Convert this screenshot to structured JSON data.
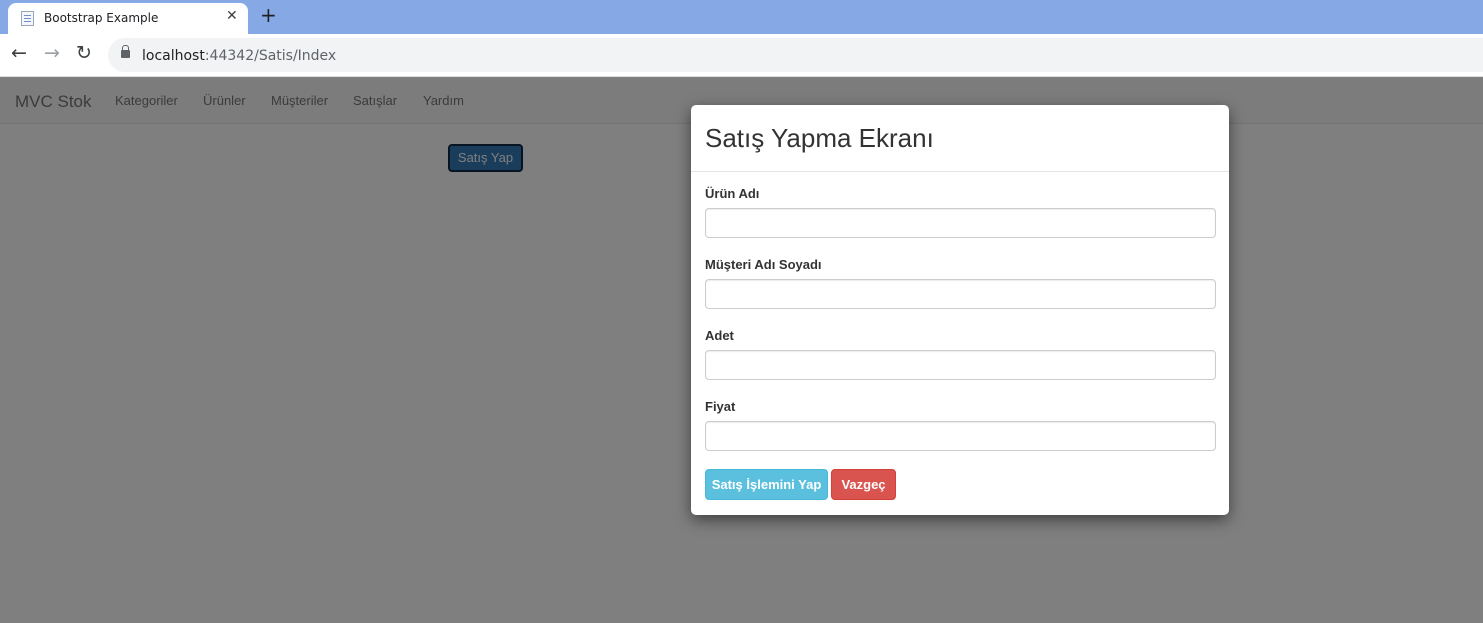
{
  "browser": {
    "tab_title": "Bootstrap Example",
    "close_glyph": "✕",
    "new_tab_glyph": "+",
    "url_host": "localhost",
    "url_rest": ":44342/Satis/Index",
    "back_glyph": "←",
    "forward_glyph": "→",
    "reload_glyph": "↻"
  },
  "navbar": {
    "brand": "MVC Stok",
    "links": [
      "Kategoriler",
      "Ürünler",
      "Müşteriler",
      "Satışlar",
      "Yardım"
    ]
  },
  "page": {
    "sell_button": "Satış Yap"
  },
  "modal": {
    "title": "Satış Yapma Ekranı",
    "fields": [
      {
        "label": "Ürün Adı",
        "value": ""
      },
      {
        "label": "Müşteri Adı Soyadı",
        "value": ""
      },
      {
        "label": "Adet",
        "value": ""
      },
      {
        "label": "Fiyat",
        "value": ""
      }
    ],
    "submit_button": "Satış İşlemini Yap",
    "cancel_button": "Vazgeç"
  },
  "colors": {
    "primary": "#337ab7",
    "info": "#5bc0de",
    "danger": "#d9534f"
  }
}
